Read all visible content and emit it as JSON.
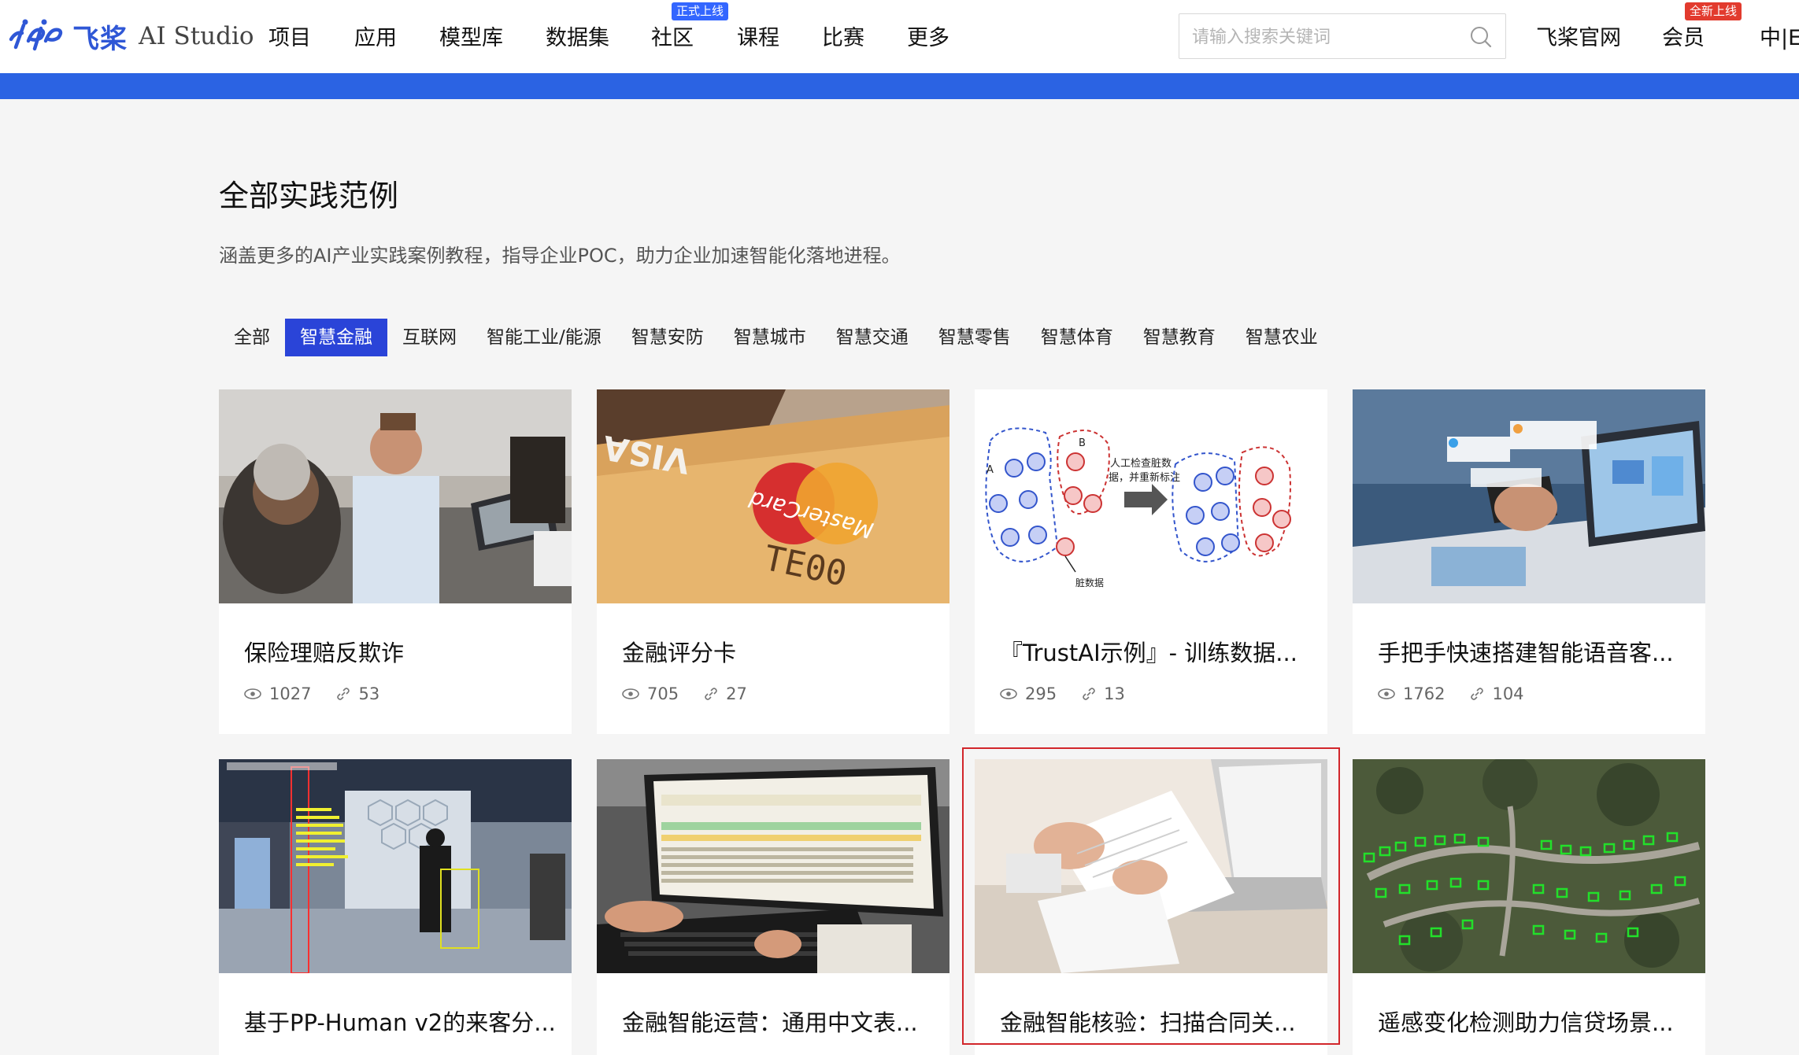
{
  "brand": {
    "name_cn": "飞桨",
    "name_en": "AI Studio",
    "color": "#2f57d6"
  },
  "nav": [
    {
      "label": "项目"
    },
    {
      "label": "应用"
    },
    {
      "label": "模型库"
    },
    {
      "label": "数据集"
    },
    {
      "label": "社区",
      "badge": "正式上线"
    },
    {
      "label": "课程"
    },
    {
      "label": "比赛"
    },
    {
      "label": "更多"
    }
  ],
  "search": {
    "placeholder": "请输入搜索关键词"
  },
  "right_nav": {
    "official": "飞桨官网",
    "member": "会员",
    "member_badge": "全新上线",
    "lang": "中|En"
  },
  "page": {
    "title": "全部实践范例",
    "subtitle": "涵盖更多的AI产业实践案例教程，指导企业POC，助力企业加速智能化落地进程。"
  },
  "tabs": [
    "全部",
    "智慧金融",
    "互联网",
    "智能工业/能源",
    "智慧安防",
    "智慧城市",
    "智慧交通",
    "智慧零售",
    "智慧体育",
    "智慧教育",
    "智慧农业"
  ],
  "active_tab": "智慧金融",
  "cards": [
    {
      "title": "保险理赔反欺诈",
      "views": "1027",
      "forks": "53"
    },
    {
      "title": "金融评分卡",
      "views": "705",
      "forks": "27"
    },
    {
      "title": "『TrustAI示例』- 训练数据...",
      "views": "295",
      "forks": "13"
    },
    {
      "title": "手把手快速搭建智能语音客...",
      "views": "1762",
      "forks": "104"
    },
    {
      "title": "基于PP-Human v2的来客分..."
    },
    {
      "title": "金融智能运营：通用中文表..."
    },
    {
      "title": "金融智能核验：扫描合同关..."
    },
    {
      "title": "遥感变化检测助力信贷场景..."
    }
  ],
  "thumb_text": {
    "visa": "VISA",
    "mastercard": "MasterCard",
    "card_number": "TE00",
    "diagram_note_1": "人工检查脏数",
    "diagram_note_2": "据，并重新标注",
    "diagram_dirty": "脏数据",
    "label_a": "A",
    "label_b": "B"
  },
  "colors": {
    "accent": "#2a44d8",
    "strip": "#2b63e3",
    "highlight": "#d2262b",
    "badge_blue": "#3366ff",
    "badge_red": "#e23b2e"
  }
}
